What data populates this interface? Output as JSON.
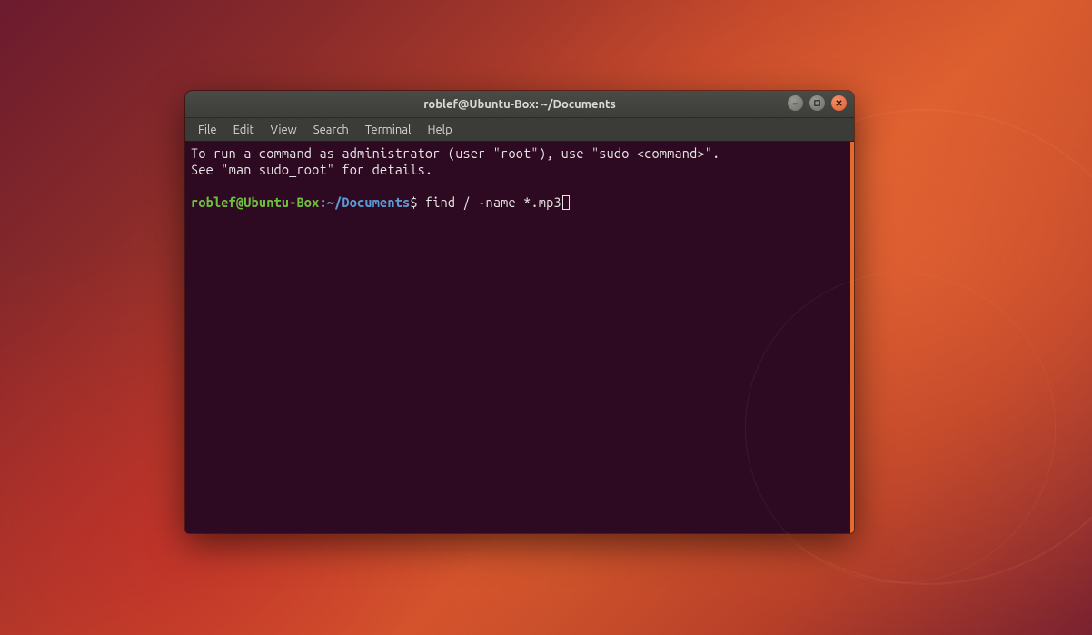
{
  "window": {
    "title": "roblef@Ubuntu-Box: ~/Documents"
  },
  "menubar": {
    "items": [
      "File",
      "Edit",
      "View",
      "Search",
      "Terminal",
      "Help"
    ]
  },
  "terminal": {
    "motd_line1": "To run a command as administrator (user \"root\"), use \"sudo <command>\".",
    "motd_line2": "See \"man sudo_root\" for details.",
    "prompt_user": "roblef@Ubuntu-Box",
    "prompt_colon": ":",
    "prompt_path": "~/Documents",
    "prompt_dollar": "$",
    "command": " find / -name *.mp3"
  },
  "colors": {
    "terminal_bg": "#2d0a22",
    "terminal_fg": "#e8e6e3",
    "prompt_user_color": "#6fbf3f",
    "prompt_path_color": "#5a9bd4",
    "close_btn": "#e35b2c",
    "accent_scroll": "#e56a2e"
  }
}
